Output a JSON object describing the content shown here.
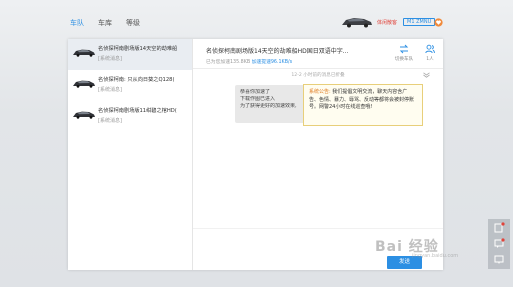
{
  "tabs": [
    {
      "label": "车队",
      "active": true
    },
    {
      "label": "车库",
      "active": false
    },
    {
      "label": "等级",
      "active": false
    }
  ],
  "header": {
    "vip_label": "体闲散客",
    "user_id": "M1 ZMNU",
    "accent": "#2c8fe3",
    "vip_color": "#e0433a"
  },
  "conversations": [
    {
      "title": "名侦探柯南剧场版14天空的劫难船",
      "subtitle": "[系统消息]"
    },
    {
      "title": "名侦探柯南: 只从向日葵之Q128(",
      "subtitle": "[系统消息]"
    },
    {
      "title": "名侦探柯南剧场版11绀碧之棺HD(",
      "subtitle": "[系统消息]"
    }
  ],
  "chat": {
    "title": "名侦探柯南剧场版14天空的劫难船HD国日双语中字...",
    "subtitle_prefix": "已为您加速135.8KB",
    "speed": "加速提速96.1KB/s",
    "switch_label": "切换车队",
    "members_label": "1人",
    "timestamp": "12-2 小时前的消息已折叠",
    "bubble_lines": [
      "恭喜你加速了",
      "下载作图已进入",
      "为了获得更好的加速效果,"
    ],
    "notice_keyword": "系统公告:",
    "notice_body": "我们提倡文明交流，聊天内容含广告、色情、暴力、辱骂、反动等都将会被封停账号。网警24小时在线巡查哦!",
    "send_label": "发送"
  },
  "watermark": {
    "text": "Bai 经验",
    "sub": "jingyan.baidu.com"
  }
}
